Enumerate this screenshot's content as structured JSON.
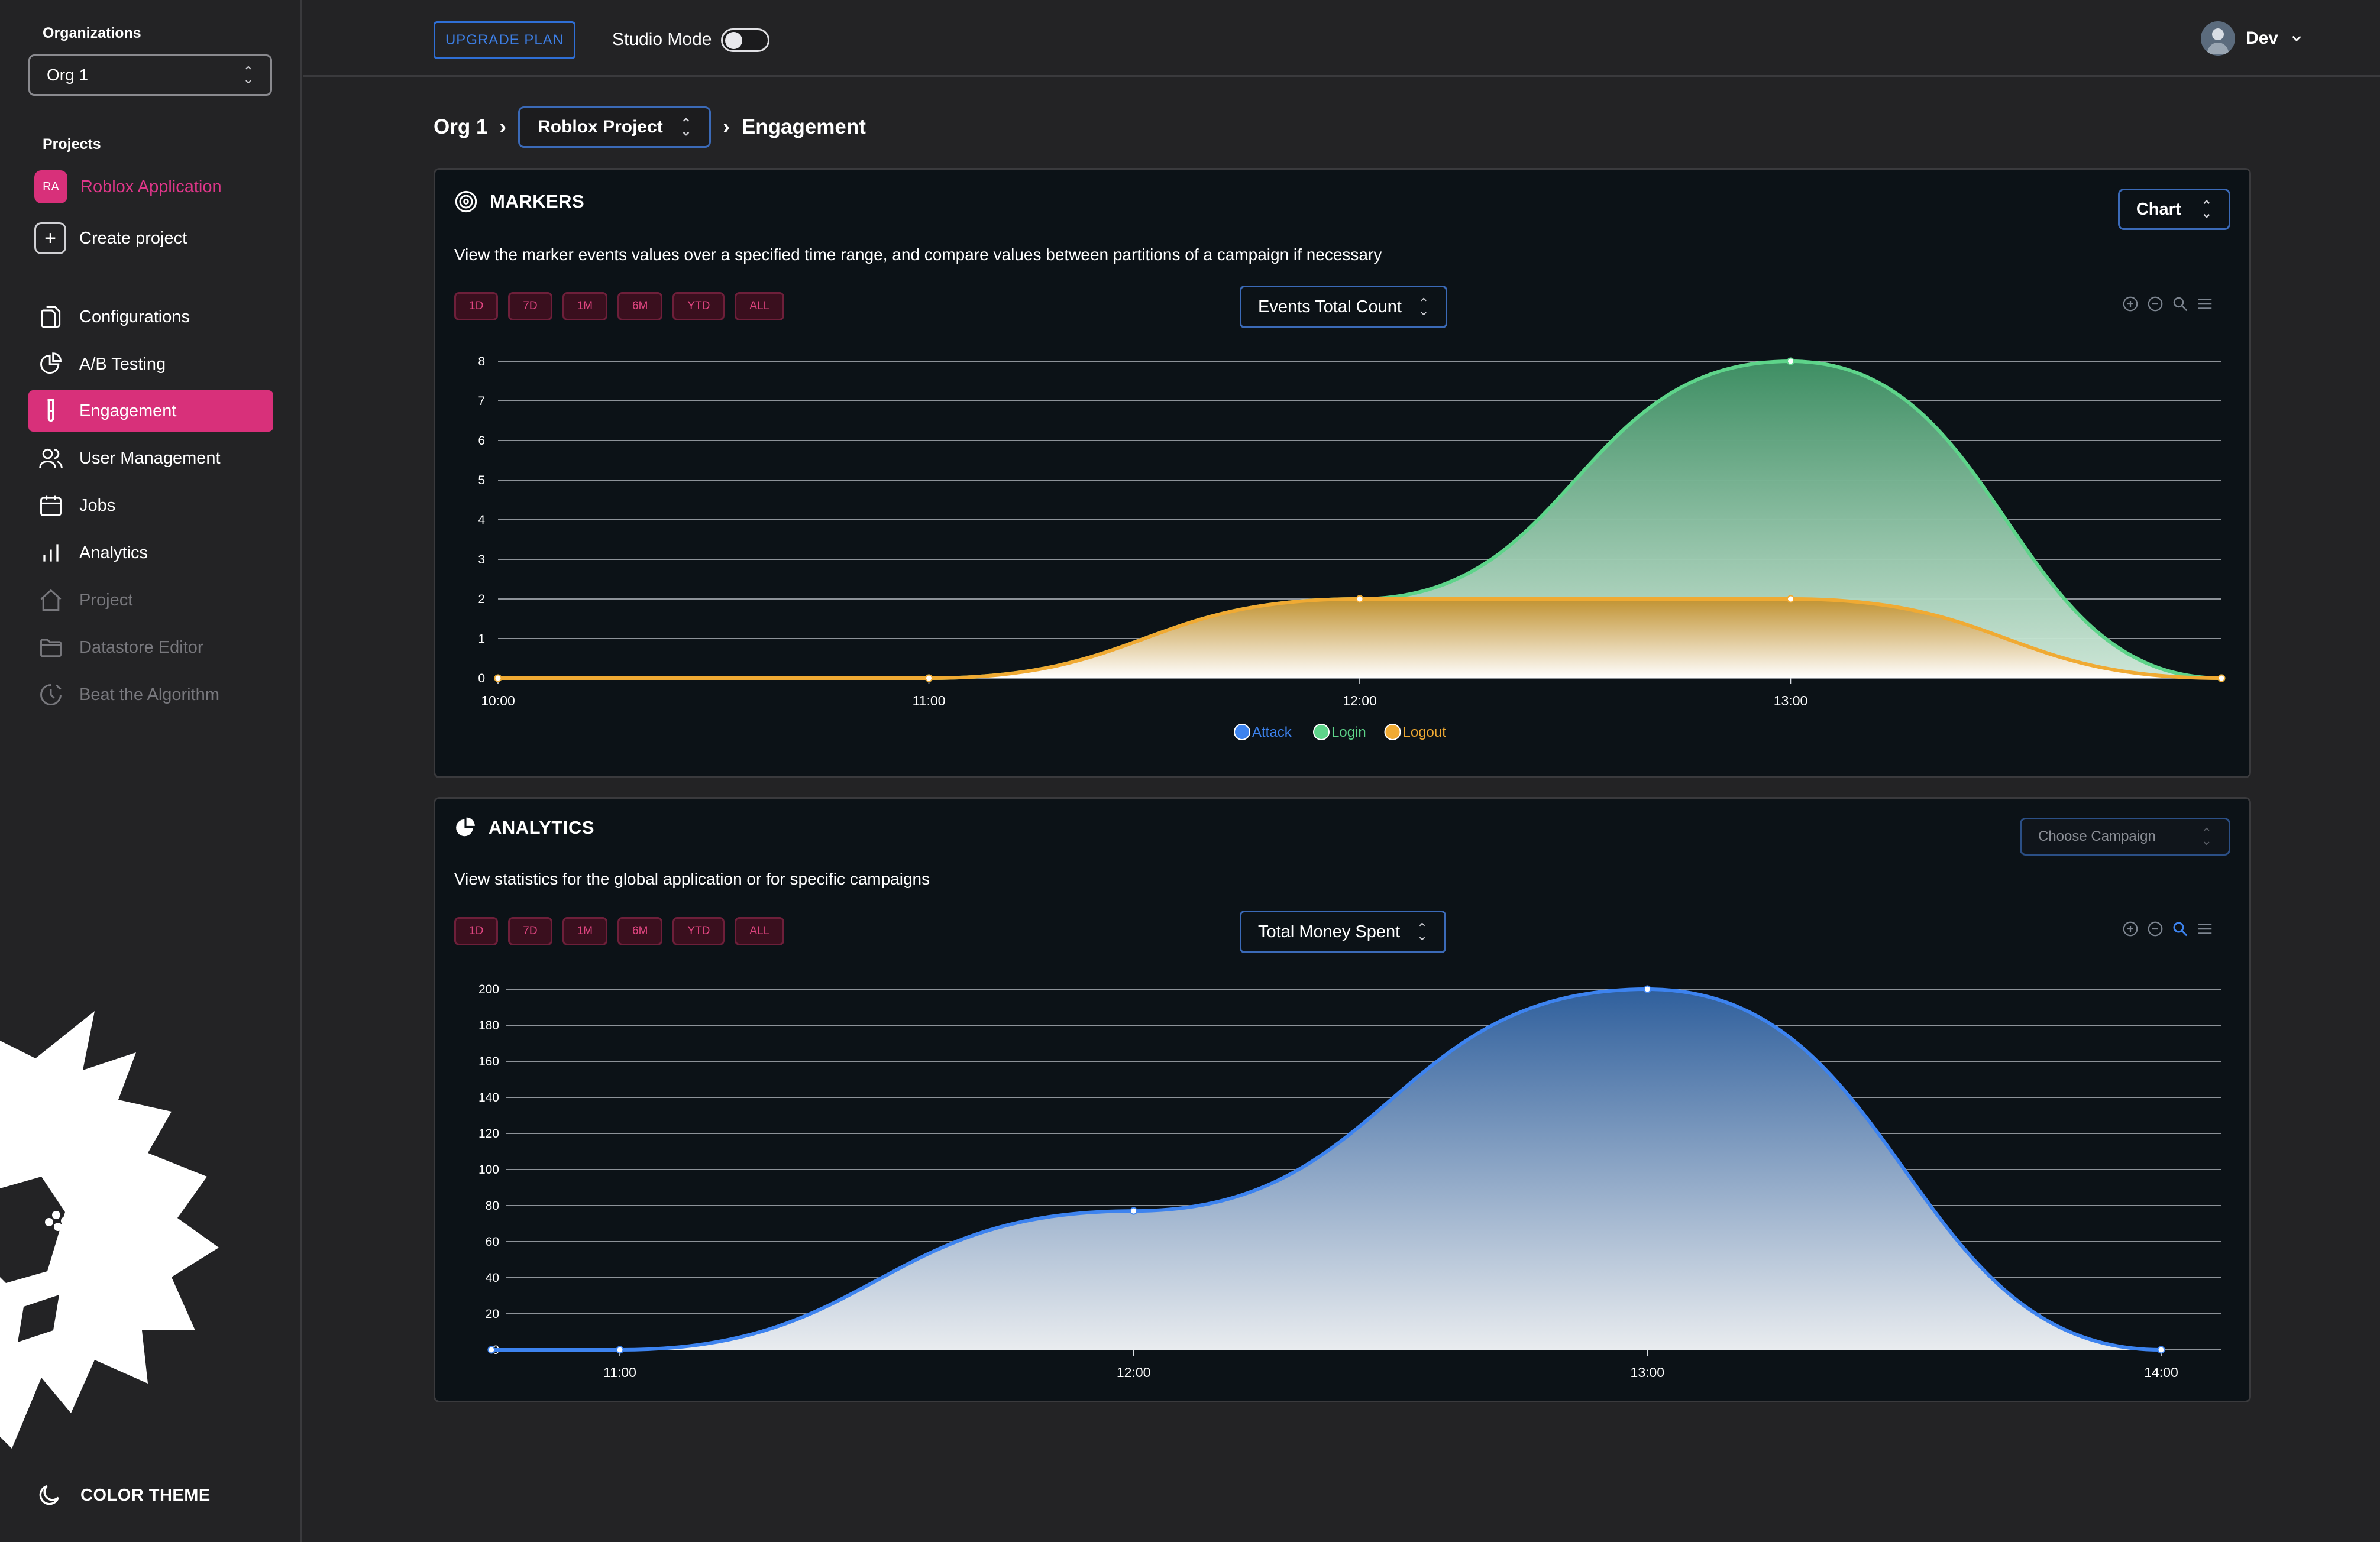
{
  "sidebar": {
    "organizations_label": "Organizations",
    "org_value": "Org 1",
    "projects_label": "Projects",
    "project_badge": "RA",
    "project_name": "Roblox Application",
    "create_project": "Create project",
    "nav": [
      {
        "label": "Configurations",
        "icon": "file-icon"
      },
      {
        "label": "A/B Testing",
        "icon": "pie-icon"
      },
      {
        "label": "Engagement",
        "icon": "test-tube-icon"
      },
      {
        "label": "User Management",
        "icon": "users-icon"
      },
      {
        "label": "Jobs",
        "icon": "calendar-icon"
      },
      {
        "label": "Analytics",
        "icon": "bar-chart-icon"
      },
      {
        "label": "Project",
        "icon": "home-icon"
      },
      {
        "label": "Datastore Editor",
        "icon": "folder-icon"
      },
      {
        "label": "Beat the Algorithm",
        "icon": "robot-icon"
      }
    ],
    "color_theme": "COLOR THEME"
  },
  "topbar": {
    "upgrade": "UPGRADE PLAN",
    "studio_mode": "Studio Mode",
    "user": "Dev"
  },
  "breadcrumb": {
    "org": "Org 1",
    "project": "Roblox Project",
    "page": "Engagement"
  },
  "markers": {
    "title": "MARKERS",
    "description": "View the marker events values over a specified time range, and compare values between partitions of a campaign if necessary",
    "view_select": "Chart",
    "metric_select": "Events Total Count",
    "ranges": [
      "1D",
      "7D",
      "1M",
      "6M",
      "YTD",
      "ALL"
    ]
  },
  "analytics": {
    "title": "ANALYTICS",
    "description": "View statistics for the global application or for specific campaigns",
    "campaign_select": "Choose Campaign",
    "metric_select": "Total Money Spent",
    "ranges": [
      "1D",
      "7D",
      "1M",
      "6M",
      "YTD",
      "ALL"
    ]
  },
  "colors": {
    "accent": "#d8307a",
    "login": "#5ed48a",
    "logout": "#f0aa33",
    "attack": "#3d83ef"
  },
  "chart_data": [
    {
      "type": "area",
      "title": "",
      "x": [
        "10:00",
        "11:00",
        "12:00",
        "13:00",
        "14:00"
      ],
      "x_tick_labels": [
        "10:00",
        "11:00",
        "12:00",
        "13:00"
      ],
      "ylim": [
        0,
        8
      ],
      "y_ticks": [
        0,
        1,
        2,
        3,
        4,
        5,
        6,
        7,
        8
      ],
      "grid": true,
      "legend_position": "bottom",
      "series": [
        {
          "name": "Attack",
          "values": [
            null,
            null,
            null,
            null,
            null
          ]
        },
        {
          "name": "Login",
          "values": [
            0,
            0,
            2,
            8,
            0
          ]
        },
        {
          "name": "Logout",
          "values": [
            0,
            0,
            2,
            2,
            0
          ]
        }
      ]
    },
    {
      "type": "area",
      "title": "",
      "x": [
        "10:45",
        "11:00",
        "12:00",
        "13:00",
        "14:00"
      ],
      "x_tick_labels": [
        "11:00",
        "12:00",
        "13:00",
        "14:00"
      ],
      "ylim": [
        0,
        200
      ],
      "y_ticks": [
        0,
        20,
        40,
        60,
        80,
        100,
        120,
        140,
        160,
        180,
        200
      ],
      "grid": true,
      "series": [
        {
          "values": [
            0,
            0,
            77,
            200,
            0
          ]
        }
      ]
    }
  ]
}
